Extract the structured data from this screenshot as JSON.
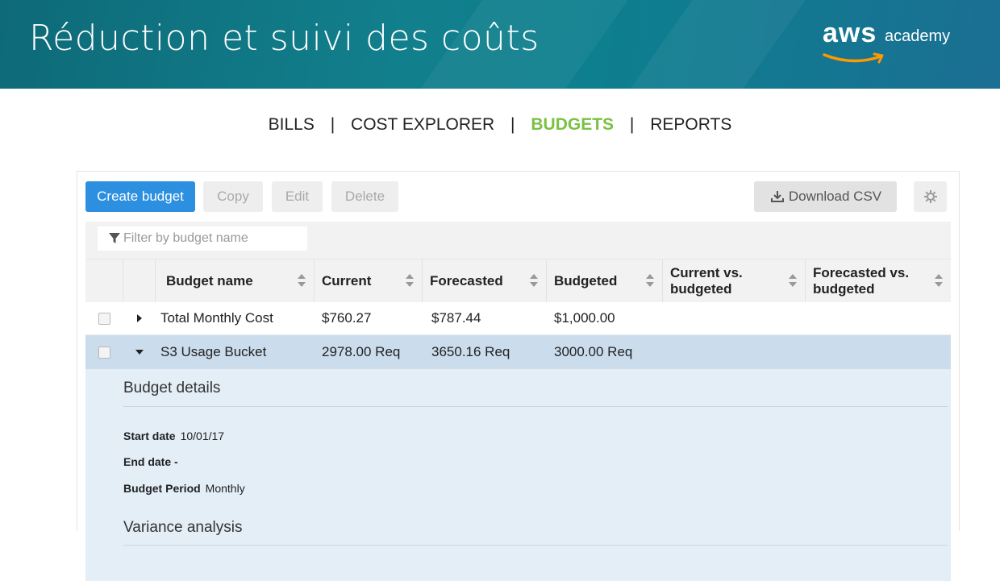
{
  "slide": {
    "title": "Réduction et suivi des coûts",
    "logo_brand": "aws",
    "logo_product": "academy"
  },
  "nav": {
    "items": [
      {
        "label": "BILLS",
        "active": false
      },
      {
        "label": "COST EXPLORER",
        "active": false
      },
      {
        "label": "BUDGETS",
        "active": true
      },
      {
        "label": "REPORTS",
        "active": false
      }
    ],
    "separator": "|"
  },
  "toolbar": {
    "create": "Create budget",
    "copy": "Copy",
    "edit": "Edit",
    "delete": "Delete",
    "download_csv": "Download CSV",
    "download_icon": "download-icon",
    "settings_icon": "gear-icon"
  },
  "filter": {
    "placeholder": "Filter by budget name",
    "icon": "filter-icon"
  },
  "table": {
    "columns": [
      "Budget name",
      "Current",
      "Forecasted",
      "Budgeted",
      "Current vs. budgeted",
      "Forecasted vs. budgeted"
    ],
    "rows": [
      {
        "name": "Total Monthly Cost",
        "current": "$760.27",
        "forecasted": "$787.44",
        "budgeted": "$1,000.00",
        "expanded": false
      },
      {
        "name": "S3 Usage Bucket",
        "current": "2978.00 Req",
        "forecasted": "3650.16 Req",
        "budgeted": "3000.00 Req",
        "expanded": true
      }
    ]
  },
  "details": {
    "heading": "Budget details",
    "start_label": "Start date",
    "start_value": "10/01/17",
    "end_label": "End date -",
    "period_label": "Budget Period",
    "period_value": "Monthly",
    "variance_heading": "Variance analysis"
  },
  "colors": {
    "primary_button": "#2d8fe0",
    "active_nav": "#7ac143",
    "selected_row": "#cbdcec",
    "banner": "#127f8c"
  }
}
